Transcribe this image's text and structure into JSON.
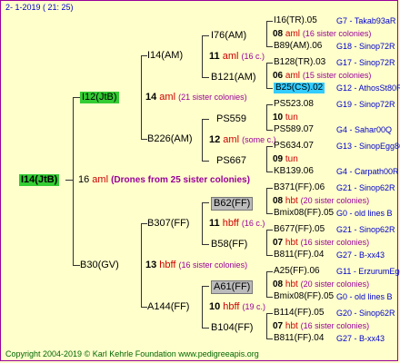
{
  "header": {
    "date": "2-   1-2019  ( 21:  25)"
  },
  "root": {
    "label": "I14(JtB)",
    "year": "16",
    "breed": " aml",
    "note": "(Drones from 25 sister colonies)"
  },
  "g1": {
    "a": {
      "label": "I12(JtB)",
      "year": "14",
      "breed": " aml",
      "note": "(21 sister colonies)"
    },
    "b": {
      "label": "B30(GV)",
      "year": "13",
      "breed": " hbff",
      "note": "(16 sister colonies)"
    }
  },
  "g2": [
    {
      "label": "I14(AM)"
    },
    {
      "label": "B226(AM)"
    },
    {
      "label": "B307(FF)"
    },
    {
      "label": "A144(FF)"
    }
  ],
  "g3": [
    {
      "label": "I76(AM)",
      "year": "11",
      "breed": " aml",
      "note": "(16 c.)",
      "box": ""
    },
    {
      "label": "B121(AM)",
      "year": "",
      "breed": "",
      "note": "",
      "box": ""
    },
    {
      "label": "PS559",
      "year": "12",
      "breed": " aml",
      "note": "(some c.)",
      "box": ""
    },
    {
      "label": "PS667",
      "year": "",
      "breed": "",
      "note": "",
      "box": ""
    },
    {
      "label": "B62(FF)",
      "year": "11",
      "breed": " hbff",
      "note": "(16 c.)",
      "box": "gray"
    },
    {
      "label": "B58(FF)",
      "year": "",
      "breed": "",
      "note": "",
      "box": ""
    },
    {
      "label": "A61(FF)",
      "year": "10",
      "breed": " hbff",
      "note": "(19 c.)",
      "box": "gray"
    },
    {
      "label": "B104(FF)",
      "year": "",
      "breed": "",
      "note": "",
      "box": ""
    }
  ],
  "g4": [
    {
      "queen": "I16(TR).05",
      "origin": "G7 - Takab93aR",
      "year": "08",
      "breed": " aml",
      "note": "(16 sister colonies)",
      "drone": "B89(AM).06",
      "dorigin": "G18 - Sinop72R"
    },
    {
      "queen": "B128(TR).03",
      "origin": "G17 - Sinop72R",
      "year": "06",
      "breed": " aml",
      "note": "(15 sister colonies)",
      "drone": "B25(CS).02",
      "dorigin": "G12 - AthosSt80R",
      "dbox": "cyan"
    },
    {
      "queen": "PS523.08",
      "origin": "G19 - Sinop72R",
      "year": "10",
      "breed": " tun",
      "note": "",
      "drone": "PS589.07",
      "dorigin": "G4 - Sahar00Q"
    },
    {
      "queen": "PS634.07",
      "origin": "G13 - SinopEgg86R",
      "year": "09",
      "breed": " tun",
      "note": "",
      "drone": "KB139.06",
      "dorigin": "G4 - Carpath00R"
    },
    {
      "queen": "B371(FF).06",
      "origin": "G21 - Sinop62R",
      "year": "08",
      "breed": " hbt",
      "note": "(20 sister colonies)",
      "drone": "Bmix08(FF).05",
      "dorigin": "G0 - old lines B"
    },
    {
      "queen": "B677(FF).05",
      "origin": "G21 - Sinop62R",
      "year": "07",
      "breed": " hbt",
      "note": "(16 sister colonies)",
      "drone": "B811(FF).04",
      "dorigin": "G27 - B-xx43"
    },
    {
      "queen": "A25(FF).06",
      "origin": "G11 - ErzurumEgg86R",
      "year": "08",
      "breed": " hbt",
      "note": "(20 sister colonies)",
      "drone": "Bmix08(FF).05",
      "dorigin": "G0 - old lines B"
    },
    {
      "queen": "B114(FF).05",
      "origin": "G20 - Sinop62R",
      "year": "07",
      "breed": " hbt",
      "note": "(16 sister colonies)",
      "drone": "B811(FF).04",
      "dorigin": "G27 - B-xx43"
    }
  ],
  "footer": {
    "copyright": "Copyright 2004-2019 © Karl Kehrle Foundation    www.pedigreeapis.org"
  }
}
